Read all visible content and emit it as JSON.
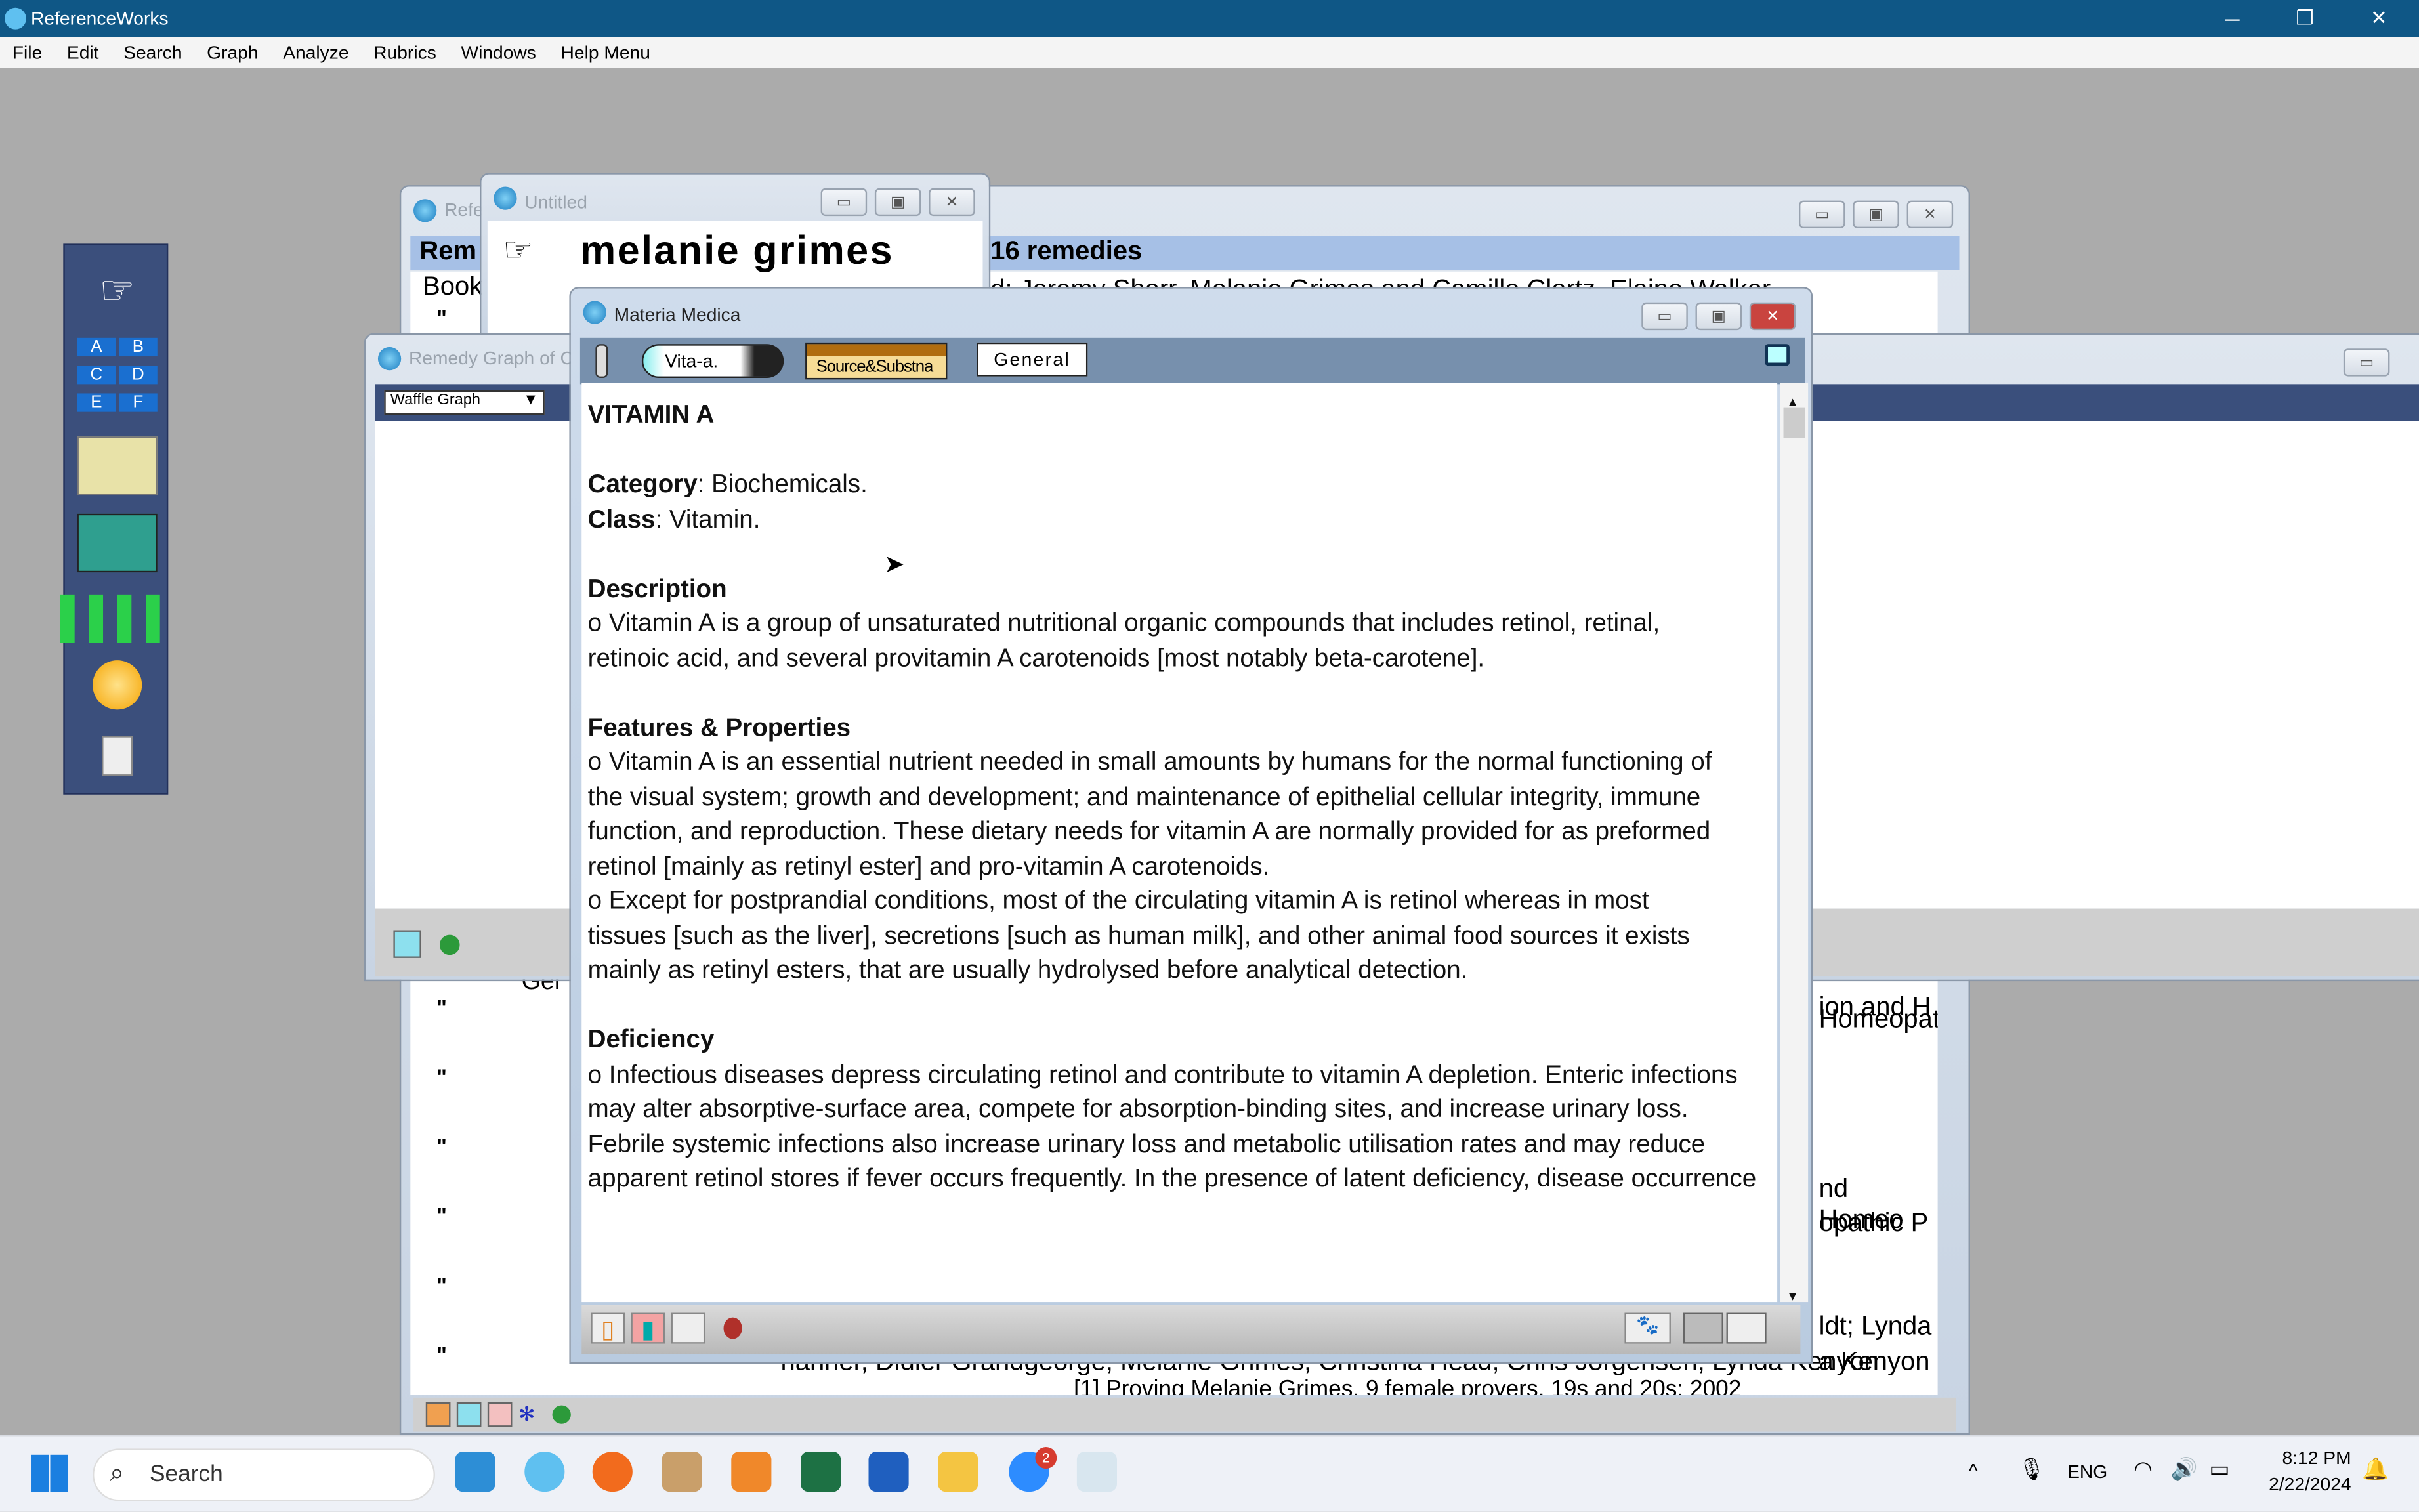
{
  "app": {
    "title": "ReferenceWorks",
    "controls": {
      "minimize": "─",
      "maximize": "❐",
      "close": "✕"
    }
  },
  "menu": [
    "File",
    "Edit",
    "Search",
    "Graph",
    "Analyze",
    "Rubrics",
    "Windows",
    "Help Menu"
  ],
  "back_window": {
    "title": "Refe",
    "header": "Rem",
    "header_right": "16 remedies",
    "row1_left": "Book",
    "row1_right": "d: Jeremy Sherr, Melanie Grimes and Camille Clertz, Elaine Walker",
    "ditto": "\"",
    "right_fragments": [
      "ion and H",
      "Homeopat",
      "nd Homeo",
      "opathic P",
      "ldt; Lynda",
      "a Kenyon"
    ],
    "left_fragment": "Ger",
    "bottom_fragments": [
      "hanner, Didier Grandgeorge, Melanie Grimes, Christina Head, Chris Jorgensen, Lynda Kenyon",
      "[1] Proving Melanie Grimes, 9 female provers, 19s and 20s; 2002"
    ]
  },
  "untitled_window": {
    "title": "Untitled",
    "text": "melanie  grimes"
  },
  "graph_window": {
    "title": "Remedy Graph of C",
    "select": "Waffle Graph"
  },
  "materia_medica": {
    "title": "Materia Medica",
    "remedy_tab": "Vita-a.",
    "source_tab": "Source&Substna",
    "general_tab": "General",
    "heading": "VITAMIN A",
    "category_label": "Category",
    "category_value": ": Biochemicals.",
    "class_label": "Class",
    "class_value": ": Vitamin.",
    "sections": [
      {
        "title": "Description",
        "paragraphs": [
          "o Vitamin A is a group of unsaturated nutritional organic compounds that includes retinol, retinal, retinoic acid, and several provitamin A carotenoids [most notably beta-carotene]."
        ]
      },
      {
        "title": "Features & Properties",
        "paragraphs": [
          "o Vitamin A is an essential nutrient needed in small amounts by humans for the normal functioning of the visual system; growth and development; and maintenance of epithelial cellular integrity, immune function, and reproduction. These dietary needs for vitamin A are normally provided for as preformed retinol [mainly as retinyl ester] and pro-vitamin A carotenoids.",
          "o Except for postprandial conditions, most of the circulating vitamin A is retinol whereas in most tissues [such as the liver], secretions [such as human milk], and other animal food sources it exists mainly as retinyl esters, that are usually hydrolysed before analytical detection."
        ]
      },
      {
        "title": "Deficiency",
        "paragraphs": [
          "o Infectious diseases depress circulating retinol and contribute to vitamin A depletion. Enteric infections may alter absorptive-surface area, compete for absorption-binding sites, and increase urinary loss. Febrile systemic infections also increase urinary loss and metabolic utilisation rates and may reduce apparent retinol stores if fever occurs frequently. In the presence of latent deficiency, disease occurrence is often associated with precipitating ocular"
        ]
      }
    ]
  },
  "taskbar": {
    "search_placeholder": "Search",
    "lang": "ENG",
    "time": "8:12 PM",
    "date": "2/22/2024",
    "zoom_badge": "2"
  }
}
